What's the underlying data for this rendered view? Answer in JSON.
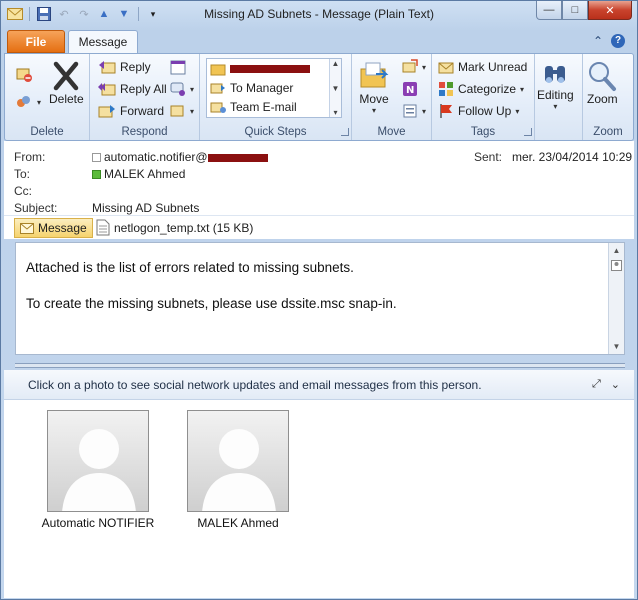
{
  "window": {
    "title": "Missing AD Subnets  -  Message (Plain Text)",
    "controls": {
      "minimize": "—",
      "maximize": "□",
      "close": "✕"
    }
  },
  "tabs": {
    "file": "File",
    "message": "Message"
  },
  "ribbon": {
    "delete_group": {
      "label": "Delete",
      "delete_button": "Delete"
    },
    "respond_group": {
      "label": "Respond",
      "reply": "Reply",
      "reply_all": "Reply All",
      "forward": "Forward"
    },
    "quick_steps_group": {
      "label": "Quick Steps",
      "items": [
        "",
        "To Manager",
        "Team E-mail"
      ]
    },
    "move_group": {
      "label": "Move",
      "move_button": "Move"
    },
    "tags_group": {
      "label": "Tags",
      "mark_unread": "Mark Unread",
      "categorize": "Categorize",
      "follow_up": "Follow Up"
    },
    "editing_group": {
      "label": "",
      "editing_button": "Editing"
    },
    "zoom_group": {
      "label": "Zoom",
      "zoom_button": "Zoom"
    }
  },
  "header": {
    "from_label": "From:",
    "from_value": "automatic.notifier@",
    "to_label": "To:",
    "to_value": "MALEK Ahmed",
    "cc_label": "Cc:",
    "subject_label": "Subject:",
    "subject_value": "Missing AD Subnets",
    "sent_label": "Sent:",
    "sent_value": "mer. 23/04/2014 10:29"
  },
  "attachments": {
    "message_chip": "Message",
    "file": "netlogon_temp.txt (15 KB)"
  },
  "body": {
    "line1": "Attached is the list of errors related to missing subnets.",
    "line2": "To create the missing subnets, please use dssite.msc snap-in."
  },
  "people_pane": {
    "info": "Click on a photo to see social network updates and email messages from this person.",
    "people": [
      "Automatic NOTIFIER",
      "MALEK Ahmed"
    ]
  },
  "colors": {
    "file_tab": "#e56f12",
    "redaction": "#8b1010",
    "presence_online": "#5bbb3a"
  }
}
